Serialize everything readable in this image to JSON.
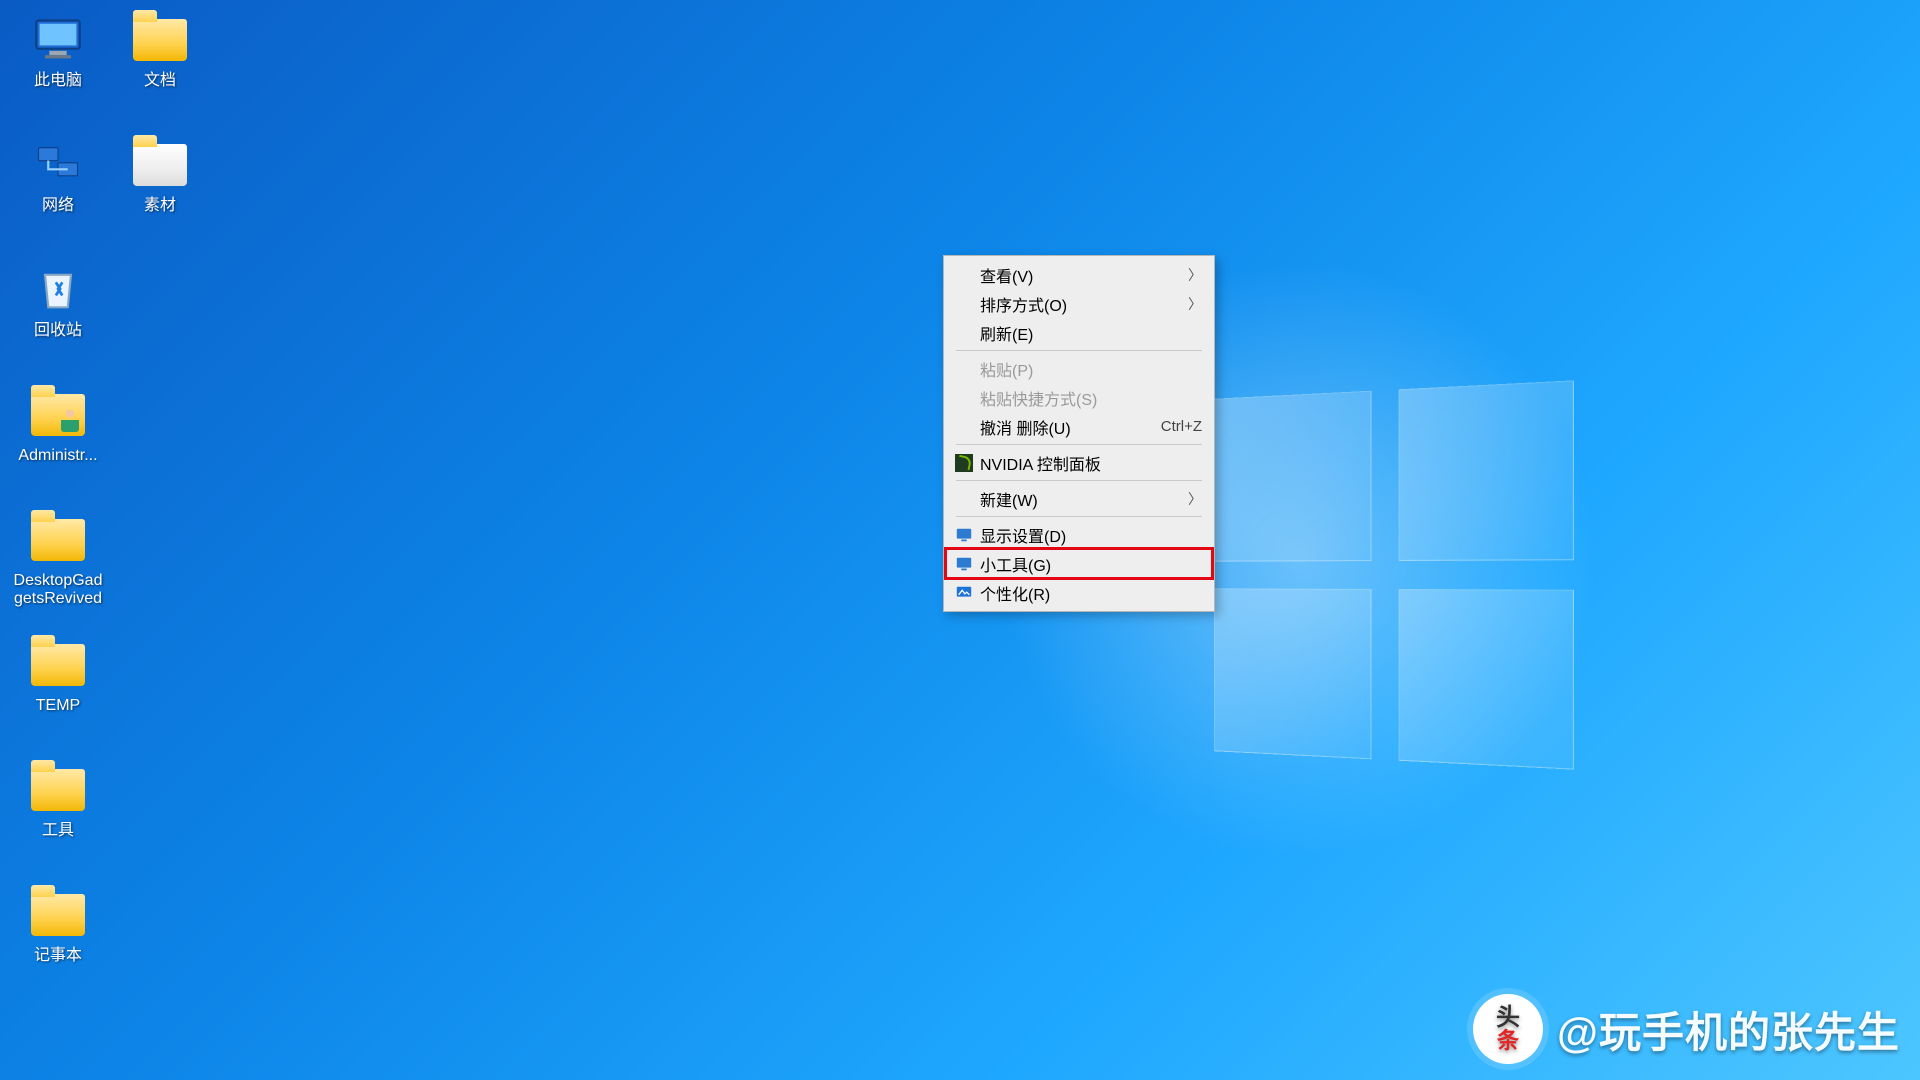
{
  "desktop_icons": {
    "col1": [
      {
        "id": "this-pc",
        "label": "此电脑",
        "icon": "monitor"
      },
      {
        "id": "network",
        "label": "网络",
        "icon": "network"
      },
      {
        "id": "recycle",
        "label": "回收站",
        "icon": "recycle"
      },
      {
        "id": "admin",
        "label": "Administr...",
        "icon": "folder-person"
      },
      {
        "id": "gadgets",
        "label": "DesktopGadgetsRevived",
        "icon": "folder"
      },
      {
        "id": "temp",
        "label": "TEMP",
        "icon": "folder"
      },
      {
        "id": "tools",
        "label": "工具",
        "icon": "folder"
      },
      {
        "id": "notepad",
        "label": "记事本",
        "icon": "folder"
      }
    ],
    "col2": [
      {
        "id": "docs",
        "label": "文档",
        "icon": "folder"
      },
      {
        "id": "assets",
        "label": "素材",
        "icon": "folder-thumb"
      }
    ]
  },
  "context_menu": {
    "view": {
      "label": "查看(V)",
      "submenu": true
    },
    "sort": {
      "label": "排序方式(O)",
      "submenu": true
    },
    "refresh": {
      "label": "刷新(E)"
    },
    "paste": {
      "label": "粘贴(P)",
      "disabled": true
    },
    "paste_short": {
      "label": "粘贴快捷方式(S)",
      "disabled": true
    },
    "undo": {
      "label": "撤消 删除(U)",
      "accel": "Ctrl+Z"
    },
    "nvidia": {
      "label": "NVIDIA 控制面板",
      "icon": "nvidia"
    },
    "new": {
      "label": "新建(W)",
      "submenu": true
    },
    "display": {
      "label": "显示设置(D)",
      "icon": "display"
    },
    "gadgets": {
      "label": "小工具(G)",
      "icon": "display",
      "highlight": true
    },
    "personalize": {
      "label": "个性化(R)",
      "icon": "personalize"
    }
  },
  "watermark": {
    "badge_top": "头",
    "badge_bottom": "条",
    "text": "@玩手机的张先生"
  }
}
